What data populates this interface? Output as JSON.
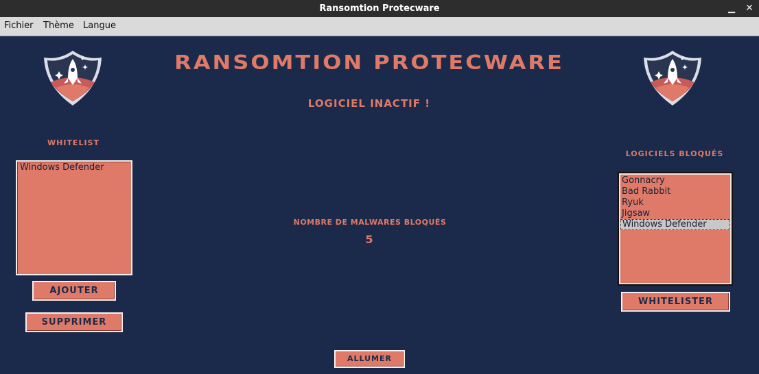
{
  "window": {
    "title": "Ransomtion Protecware",
    "minimize_icon": "minimize-icon",
    "close_icon": "close-icon"
  },
  "menu": [
    "Fichier",
    "Thème",
    "Langue"
  ],
  "header": {
    "app_title": "RANSOMTION PROTECWARE",
    "status": "LOGICIEL INACTIF !"
  },
  "logo": {
    "icon": "rocket-shield-logo",
    "colors": {
      "shield": "#2a3552",
      "border": "#d9dee8",
      "rocket": "#ffffff",
      "flame": "#c85a5a"
    }
  },
  "whitelist": {
    "title": "WHITELIST",
    "items": [
      "Windows Defender"
    ],
    "add_label": "AJOUTER",
    "remove_label": "SUPPRIMER"
  },
  "blocked": {
    "title": "LOGICIELS BLOQUÉS",
    "items": [
      "Gonnacry",
      "Bad Rabbit",
      "Ryuk",
      "Jigsaw",
      "Windows Defender"
    ],
    "selected": "Windows Defender",
    "whitelist_label": "WHITELISTER"
  },
  "stats": {
    "label": "NOMBRE DE MALWARES BLOQUÉS",
    "count": "5"
  },
  "power": {
    "label": "ALLUMER"
  },
  "colors": {
    "background": "#1b2a4a",
    "accent": "#e07a68",
    "text_dark": "#1a2035"
  }
}
